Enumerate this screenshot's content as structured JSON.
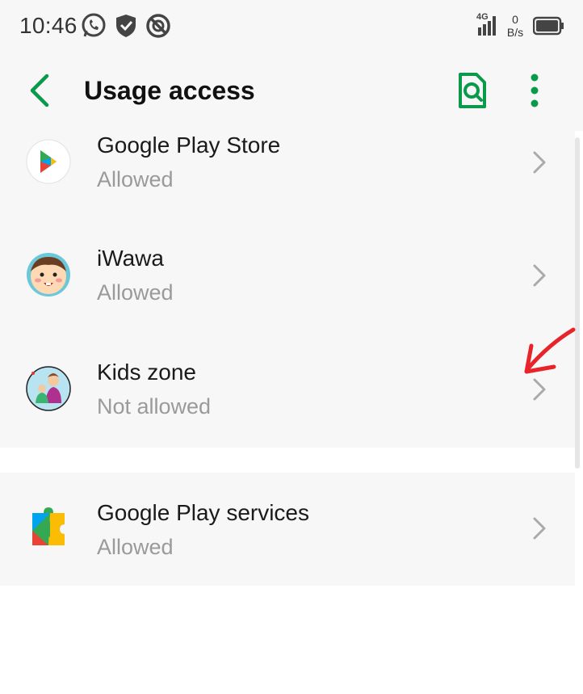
{
  "status_bar": {
    "time": "10:46",
    "network": "4G",
    "speed_value": "0",
    "speed_unit": "B/s",
    "left_icons": [
      "whatsapp-icon",
      "shield-icon",
      "block-icon"
    ],
    "right_icons": [
      "signal-icon",
      "battery-icon"
    ]
  },
  "header": {
    "title": "Usage access",
    "actions": [
      "search-icon",
      "more-icon"
    ],
    "accent_color": "#0a9a4a"
  },
  "apps": [
    {
      "name": "Google Play Store",
      "status": "Allowed",
      "icon": "google-play-store-icon"
    },
    {
      "name": "iWawa",
      "status": "Allowed",
      "icon": "iwawa-icon"
    },
    {
      "name": "Kids zone",
      "status": "Not allowed",
      "icon": "kids-zone-icon"
    },
    {
      "name": "Google Play services",
      "status": "Allowed",
      "icon": "google-play-services-icon"
    }
  ],
  "annotation": {
    "icon": "red-arrow-icon",
    "color": "#e8232a"
  }
}
